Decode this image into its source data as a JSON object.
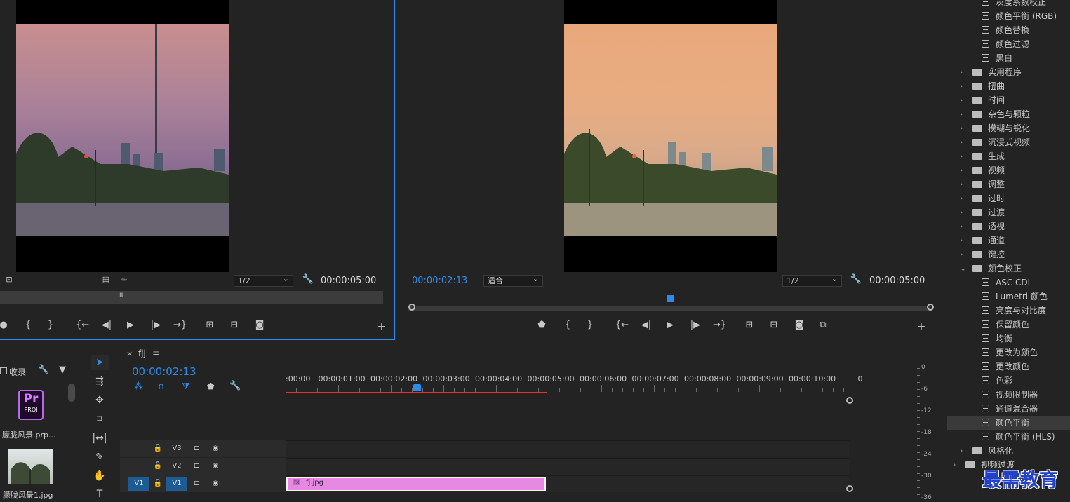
{
  "source_monitor": {
    "zoom": "1/2",
    "timecode": "00:00:05:00"
  },
  "program_monitor": {
    "current_time": "00:00:02:13",
    "fit": "适合",
    "zoom": "1/2",
    "timecode": "00:00:05:00"
  },
  "project": {
    "tab": "收录",
    "items": [
      {
        "name": "朦胧风景.prp...",
        "badge": "Pr",
        "badge_sub": "PROJ"
      },
      {
        "name": "朦胧风景1.jpg"
      }
    ]
  },
  "timeline": {
    "tab": "fjj",
    "timecode": "00:00:02:13",
    "ruler": [
      ":00:00",
      "00:00:01:00",
      "00:00:02:00",
      "00:00:03:00",
      "00:00:04:00",
      "00:00:05:00",
      "00:00:06:00",
      "00:00:07:00",
      "00:00:08:00",
      "00:00:09:00",
      "00:00:10:00",
      "0"
    ],
    "tracks": [
      {
        "name": "V3"
      },
      {
        "name": "V2"
      },
      {
        "name": "V1",
        "source": "V1"
      }
    ],
    "clip": {
      "label": "fj.jpg",
      "fx": "fx",
      "color": "#e58ae0"
    }
  },
  "meter": {
    "labels": [
      "0",
      "-6",
      "-12",
      "-18",
      "-24",
      "-30",
      "-36"
    ]
  },
  "effects": {
    "items": [
      {
        "label": "灰度系数校正",
        "type": "preset",
        "indent": 2
      },
      {
        "label": "颜色平衡 (RGB)",
        "type": "preset",
        "indent": 2
      },
      {
        "label": "颜色替换",
        "type": "preset",
        "indent": 2
      },
      {
        "label": "颜色过滤",
        "type": "preset",
        "indent": 2
      },
      {
        "label": "黑白",
        "type": "preset",
        "indent": 2
      },
      {
        "label": "实用程序",
        "type": "folder",
        "indent": 1
      },
      {
        "label": "扭曲",
        "type": "folder",
        "indent": 1
      },
      {
        "label": "时间",
        "type": "folder",
        "indent": 1
      },
      {
        "label": "杂色与颗粒",
        "type": "folder",
        "indent": 1
      },
      {
        "label": "模糊与锐化",
        "type": "folder",
        "indent": 1
      },
      {
        "label": "沉浸式视频",
        "type": "folder",
        "indent": 1
      },
      {
        "label": "生成",
        "type": "folder",
        "indent": 1
      },
      {
        "label": "视频",
        "type": "folder",
        "indent": 1
      },
      {
        "label": "调整",
        "type": "folder",
        "indent": 1
      },
      {
        "label": "过时",
        "type": "folder",
        "indent": 1
      },
      {
        "label": "过渡",
        "type": "folder",
        "indent": 1
      },
      {
        "label": "透视",
        "type": "folder",
        "indent": 1
      },
      {
        "label": "通道",
        "type": "folder",
        "indent": 1
      },
      {
        "label": "键控",
        "type": "folder",
        "indent": 1
      },
      {
        "label": "颜色校正",
        "type": "folder-open",
        "indent": 1
      },
      {
        "label": "ASC CDL",
        "type": "preset",
        "indent": 2
      },
      {
        "label": "Lumetri 颜色",
        "type": "preset",
        "indent": 2
      },
      {
        "label": "亮度与对比度",
        "type": "preset",
        "indent": 2
      },
      {
        "label": "保留颜色",
        "type": "preset",
        "indent": 2
      },
      {
        "label": "均衡",
        "type": "preset",
        "indent": 2
      },
      {
        "label": "更改为颜色",
        "type": "preset",
        "indent": 2
      },
      {
        "label": "更改颜色",
        "type": "preset",
        "indent": 2
      },
      {
        "label": "色彩",
        "type": "preset",
        "indent": 2
      },
      {
        "label": "视频限制器",
        "type": "preset",
        "indent": 2
      },
      {
        "label": "通道混合器",
        "type": "preset",
        "indent": 2
      },
      {
        "label": "颜色平衡",
        "type": "preset",
        "indent": 2,
        "selected": true
      },
      {
        "label": "颜色平衡 (HLS)",
        "type": "preset",
        "indent": 2
      },
      {
        "label": "风格化",
        "type": "folder",
        "indent": 1
      },
      {
        "label": "视频过渡",
        "type": "folder",
        "indent": 0
      }
    ]
  },
  "watermark": "最需教育"
}
